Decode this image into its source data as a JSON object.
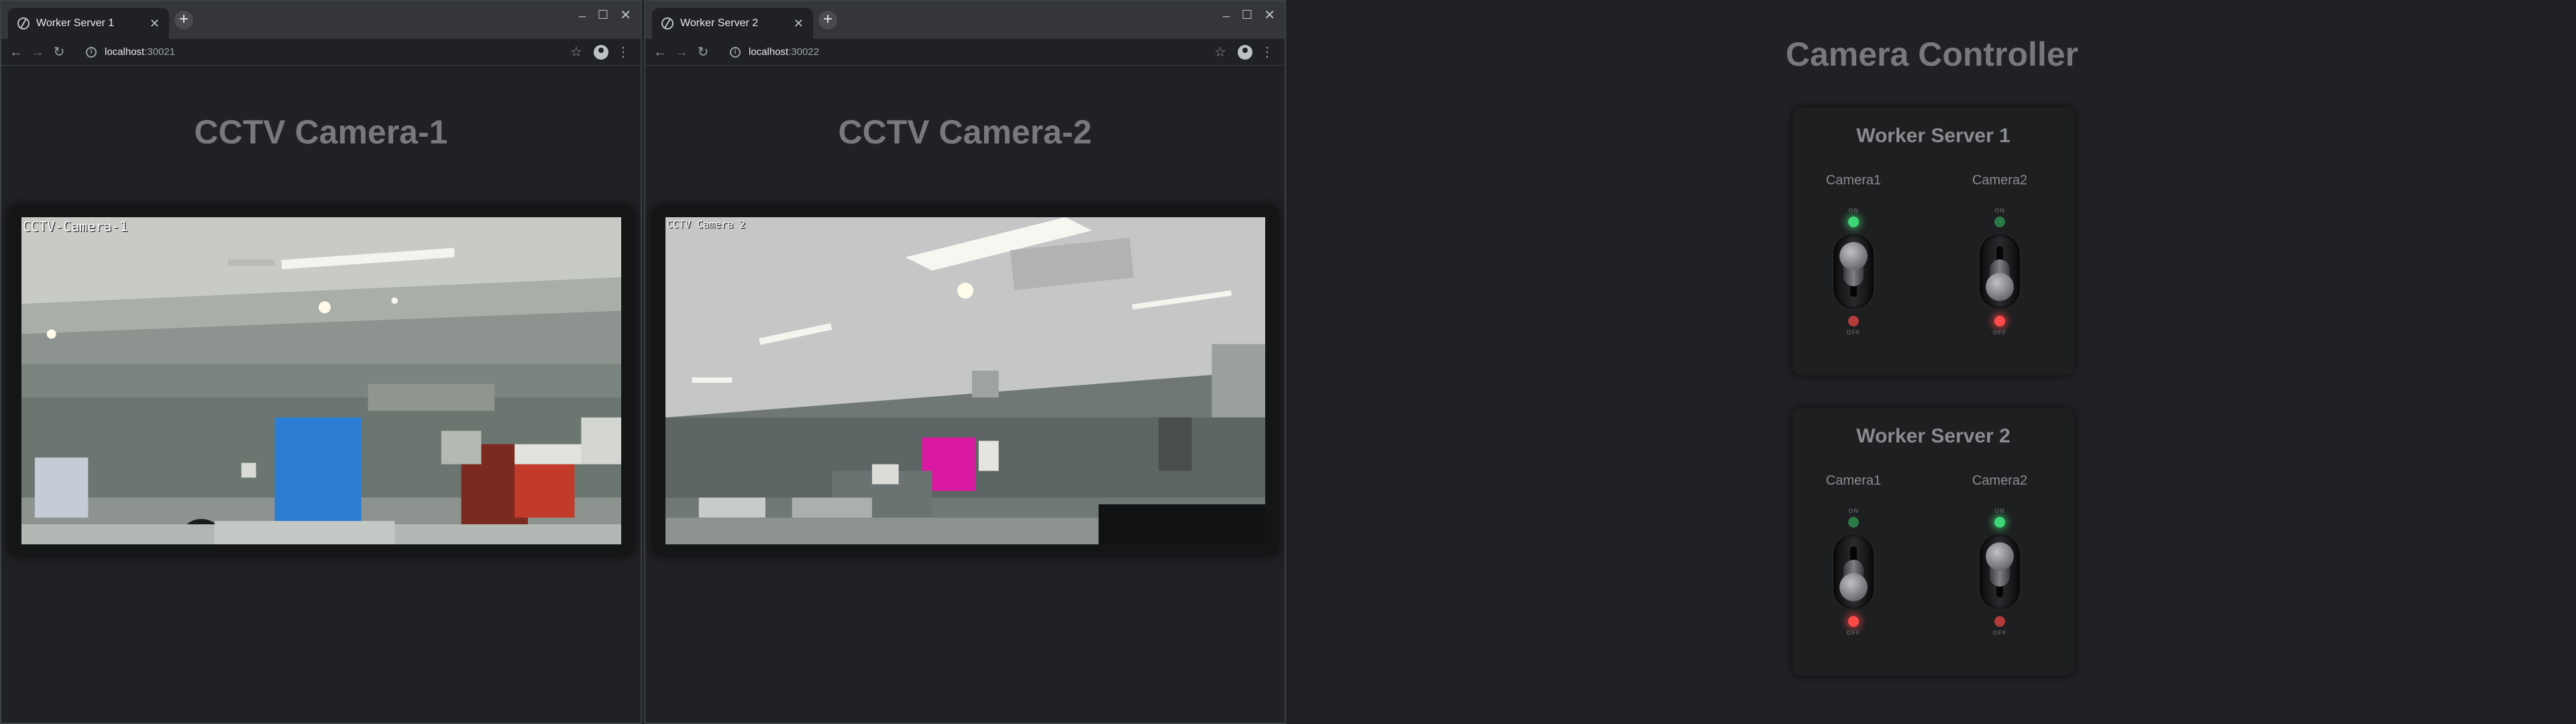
{
  "windows": [
    {
      "tab_title": "Worker Server 1",
      "url_host": "localhost",
      "url_port": ":30021",
      "page_title": "CCTV Camera-1",
      "overlay_label": "CCTV-Camera-1"
    },
    {
      "tab_title": "Worker Server 2",
      "url_host": "localhost",
      "url_port": ":30022",
      "page_title": "CCTV Camera-2",
      "overlay_label": "CCTV Camera 2"
    }
  ],
  "controller": {
    "title": "Camera Controller",
    "servers": [
      {
        "name": "Worker Server 1",
        "cameras": [
          {
            "label": "Camera1",
            "state": "on",
            "on_label": "ON",
            "off_label": "OFF"
          },
          {
            "label": "Camera2",
            "state": "off",
            "on_label": "ON",
            "off_label": "OFF"
          }
        ]
      },
      {
        "name": "Worker Server 2",
        "cameras": [
          {
            "label": "Camera1",
            "state": "off",
            "on_label": "ON",
            "off_label": "OFF"
          },
          {
            "label": "Camera2",
            "state": "on",
            "on_label": "ON",
            "off_label": "OFF"
          }
        ]
      }
    ]
  },
  "icons": {
    "back": "back-arrow-icon",
    "forward": "forward-arrow-icon",
    "reload": "reload-icon",
    "info": "site-info-icon",
    "star": "bookmark-star-icon",
    "profile": "profile-icon",
    "menu": "kebab-menu-icon"
  },
  "colors": {
    "led_on_green": "#3fd675",
    "led_on_red": "#ff4a4a",
    "title_gray": "#77797c"
  }
}
